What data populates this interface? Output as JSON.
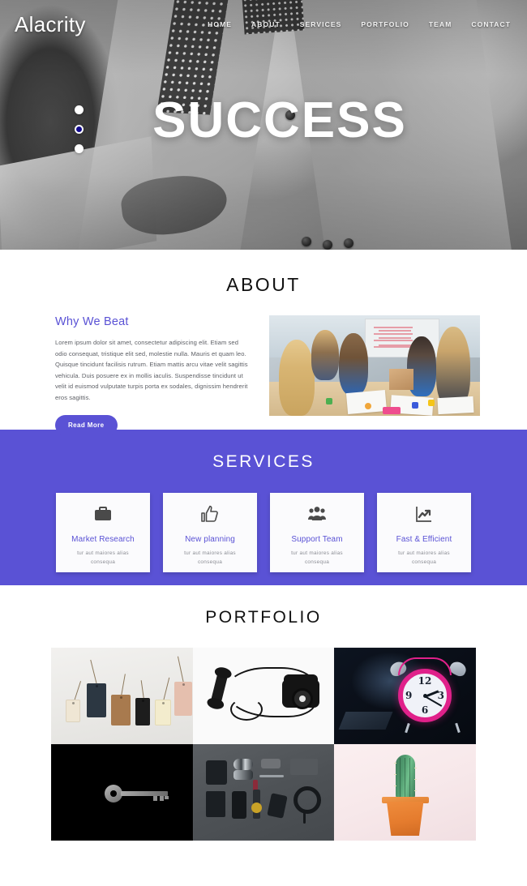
{
  "site": {
    "logo": "Alacrity"
  },
  "nav": {
    "items": [
      {
        "label": "HOME"
      },
      {
        "label": "ABOUT"
      },
      {
        "label": "SERVICES"
      },
      {
        "label": "PORTFOLIO"
      },
      {
        "label": "TEAM"
      },
      {
        "label": "CONTACT"
      }
    ]
  },
  "hero": {
    "title": "SUCCESS",
    "slides": [
      {
        "active": false
      },
      {
        "active": true
      },
      {
        "active": false
      }
    ]
  },
  "about": {
    "section_title": "ABOUT",
    "heading": "Why We Beat",
    "body": "Lorem ipsum dolor sit amet, consectetur adipiscing elit. Etiam sed odio consequat, tristique elit sed, molestie nulla. Mauris et quam leo. Quisque tincidunt facilisis rutrum. Etiam mattis arcu vitae velit sagittis vehicula. Duis posuere ex in mollis iaculis. Suspendisse tincidunt ut velit id euismod vulputate turpis porta ex sodales, dignissim hendrerit eros sagittis.",
    "button_label": "Read More",
    "image_alt": "team-meeting-photo"
  },
  "services": {
    "section_title": "SERVICES",
    "background_color": "#5a52d5",
    "cards": [
      {
        "icon": "briefcase-icon",
        "title": "Market Research",
        "subtitle": "tur aut maiores alias consequa"
      },
      {
        "icon": "thumbs-up-icon",
        "title": "New planning",
        "subtitle": "tur aut maiores alias consequa"
      },
      {
        "icon": "users-group-icon",
        "title": "Support Team",
        "subtitle": "tur aut maiores alias consequa"
      },
      {
        "icon": "chart-line-up-icon",
        "title": "Fast & Efficient",
        "subtitle": "tur aut maiores alias consequa"
      }
    ]
  },
  "portfolio": {
    "section_title": "PORTFOLIO",
    "items": [
      {
        "alt": "price-tags-photo"
      },
      {
        "alt": "rotary-telephone-photo"
      },
      {
        "alt": "pink-alarm-clock-photo"
      },
      {
        "alt": "key-on-black-photo"
      },
      {
        "alt": "accessories-flatlay-photo"
      },
      {
        "alt": "cactus-in-pot-photo"
      }
    ]
  },
  "theme": {
    "accent": "#5a52d5",
    "heading_color": "#111111",
    "body_text_color": "#5e6066"
  },
  "clock": {
    "numbers": [
      "12",
      "3",
      "6",
      "9"
    ]
  }
}
